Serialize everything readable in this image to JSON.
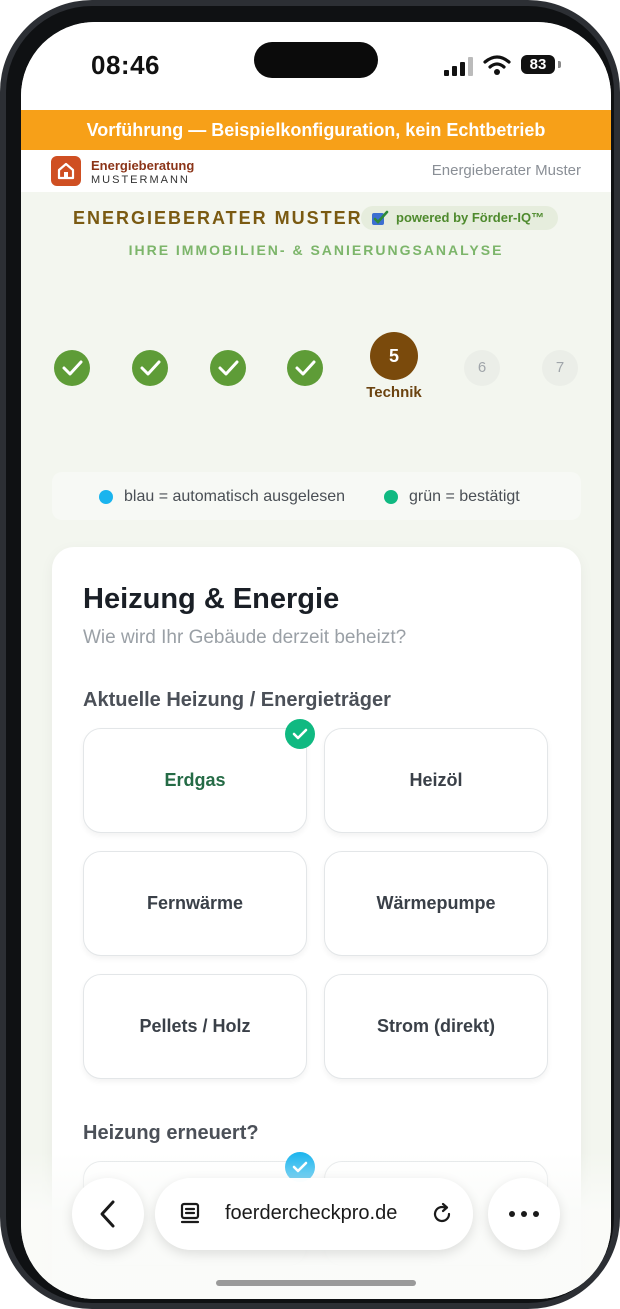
{
  "status_bar": {
    "time": "08:46",
    "battery": "83"
  },
  "demo_banner": "Vorführung — Beispielkonfiguration, kein Echtbetrieb",
  "header": {
    "brand_line1": "Energieberatung",
    "brand_line2": "MUSTERMANN",
    "advisor": "Energieberater Muster"
  },
  "hero": {
    "consultant": "ENERGIEBERATER MUSTER",
    "powered_by": "powered by Förder-IQ™",
    "subtitle": "IHRE IMMOBILIEN- & SANIERUNGSANALYSE"
  },
  "stepper": {
    "current_number": "5",
    "current_label": "Technik",
    "pending": [
      "6",
      "7"
    ]
  },
  "legend": {
    "blue": "blau = automatisch ausgelesen",
    "green": "grün = bestätigt"
  },
  "card": {
    "title": "Heizung & Energie",
    "subtitle": "Wie wird Ihr Gebäude derzeit beheizt?",
    "heating_label": "Aktuelle Heizung / Energieträger",
    "options": [
      "Erdgas",
      "Heizöl",
      "Fernwärme",
      "Wärmepumpe",
      "Pellets / Holz",
      "Strom (direkt)"
    ],
    "selected_option": "Erdgas",
    "renewed_label": "Heizung erneuert?"
  },
  "browser": {
    "url": "foerdercheckpro.de"
  },
  "colors": {
    "accent_orange": "#f7a018",
    "done_green": "#5e9c37",
    "current_brown": "#7a4a0c",
    "confirm_green": "#10b981",
    "auto_blue": "#1ab4ee"
  }
}
